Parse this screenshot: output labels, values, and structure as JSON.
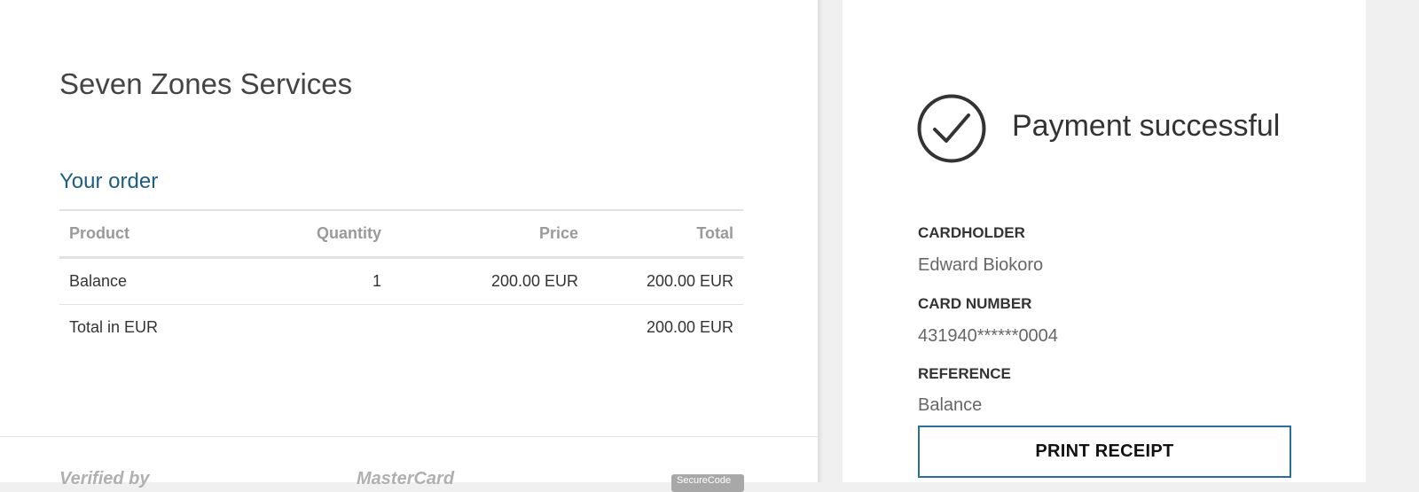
{
  "merchant": {
    "name": "Seven Zones Services"
  },
  "order": {
    "title": "Your order",
    "headers": {
      "product": "Product",
      "quantity": "Quantity",
      "price": "Price",
      "total": "Total"
    },
    "rows": [
      {
        "product": "Balance",
        "quantity": "1",
        "price": "200.00 EUR",
        "total": "200.00 EUR"
      }
    ],
    "total_label": "Total in EUR",
    "total_value": "200.00 EUR"
  },
  "footer_logos": {
    "verified": "Verified by",
    "mastercard": "MasterCard",
    "badge": "SecureCode"
  },
  "payment": {
    "status_title": "Payment successful",
    "status_icon": "check-circle-icon",
    "cardholder_label": "CARDHOLDER",
    "cardholder_value": "Edward Biokoro",
    "card_number_label": "CARD NUMBER",
    "card_number_value": "431940******0004",
    "reference_label": "REFERENCE",
    "reference_value": "Balance",
    "print_button_label": "PRINT RECEIPT"
  },
  "colors": {
    "accent": "#1d5d7f",
    "button_border": "#2a6f97",
    "background": "#f0f0f0"
  }
}
